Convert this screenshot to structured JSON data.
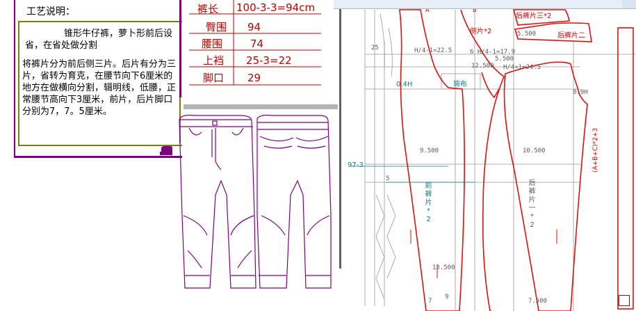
{
  "notes": {
    "title": "工艺说明：",
    "paragraph1": "锥形牛仔裤，萝卜形前后设省，在省处做分割",
    "paragraph2": "将裤片分为前后侧三片。后片有分为三片，省转为育克，在腰节向下6厘米的地方在做横向分割，辑明线，低腰，正常腰节高向下3厘米，前片，后片脚口分别为7，7。5厘米。"
  },
  "spec_table": {
    "rows": [
      {
        "label": "裤长",
        "value": "100-3-3=94cm"
      },
      {
        "label": "臀围",
        "value": "94"
      },
      {
        "label": "腰围",
        "value": "74"
      },
      {
        "label": "上裆",
        "value": "25-3=22"
      },
      {
        "label": "脚口",
        "value": "29"
      }
    ]
  },
  "pattern": {
    "labels": {
      "back_yoke_3": "后裤片三*2",
      "side_piece": "侧片*2",
      "back_piece_2": "后裤片二",
      "m_5500": "5.500",
      "m_5500b": "5.500",
      "m_25": "25",
      "h4_front": "H/4-1=22.5",
      "h4_mid": "6  H/4-1=17.9",
      "h4_back": "H/4+1=24.5",
      "m_12500": "12.500",
      "m_04h": "0.4H",
      "m_09h": "0.9H",
      "pocket": "袋布",
      "m_9500": "9.500",
      "m_10500": "10.500",
      "m_97_3": "97-3",
      "m_5": "5",
      "front_piece": "前裤片*2",
      "back_piece_1": "后裤片一*2",
      "m_13500": "13.500",
      "m_7500": "7.500",
      "m_7": "7",
      "m_9": "9",
      "a": "A",
      "b": "B",
      "waistband": "(A+B+C)*2+3"
    }
  },
  "colors": {
    "pattern_red": "#e01010",
    "purple": "#800080",
    "olive": "#808000",
    "teal": "#0a7a8a",
    "grey": "#999999"
  }
}
